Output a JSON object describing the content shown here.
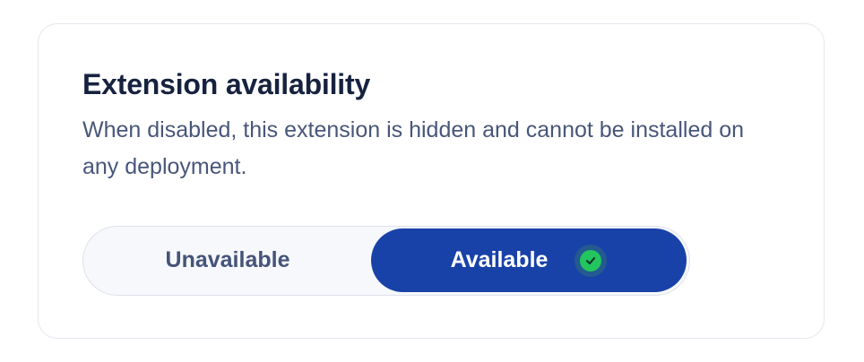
{
  "section": {
    "title": "Extension availability",
    "description": "When disabled, this extension is hidden and cannot be installed on any deployment."
  },
  "availability_toggle": {
    "options": [
      {
        "label": "Unavailable",
        "selected": false
      },
      {
        "label": "Available",
        "selected": true
      }
    ]
  },
  "colors": {
    "selected_bg": "#1942a8",
    "check_green": "#22c55e",
    "title_text": "#16223f",
    "body_text": "#48567a"
  },
  "icons": {
    "selected_indicator": "check-circle-icon"
  }
}
